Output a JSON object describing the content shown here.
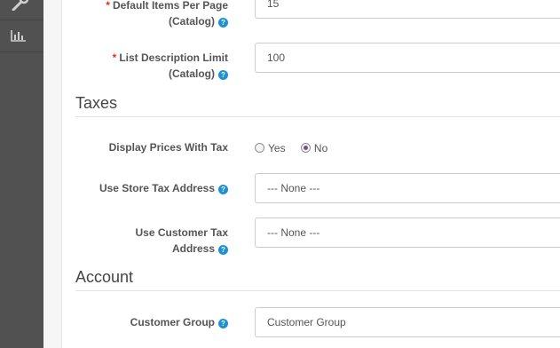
{
  "sidebar": {
    "icons": [
      "wrench-icon",
      "bar-chart-icon"
    ]
  },
  "fields": {
    "items_per_page": {
      "label_line1": "Default Items Per Page",
      "label_line2": "(Catalog)",
      "value": "15"
    },
    "desc_limit": {
      "label_line1": "List Description Limit",
      "label_line2": "(Catalog)",
      "value": "100"
    },
    "display_prices_tax": {
      "label": "Display Prices With Tax",
      "options": [
        "Yes",
        "No"
      ],
      "selected": "No"
    },
    "store_tax_address": {
      "label": "Use Store Tax Address",
      "value": "--- None ---"
    },
    "customer_tax_address": {
      "label_line1": "Use Customer Tax",
      "label_line2": "Address",
      "value": "--- None ---"
    },
    "customer_group": {
      "label": "Customer Group",
      "value": "Customer Group"
    }
  },
  "sections": {
    "taxes": "Taxes",
    "account": "Account"
  },
  "required_mark": "*",
  "help_glyph": "?"
}
